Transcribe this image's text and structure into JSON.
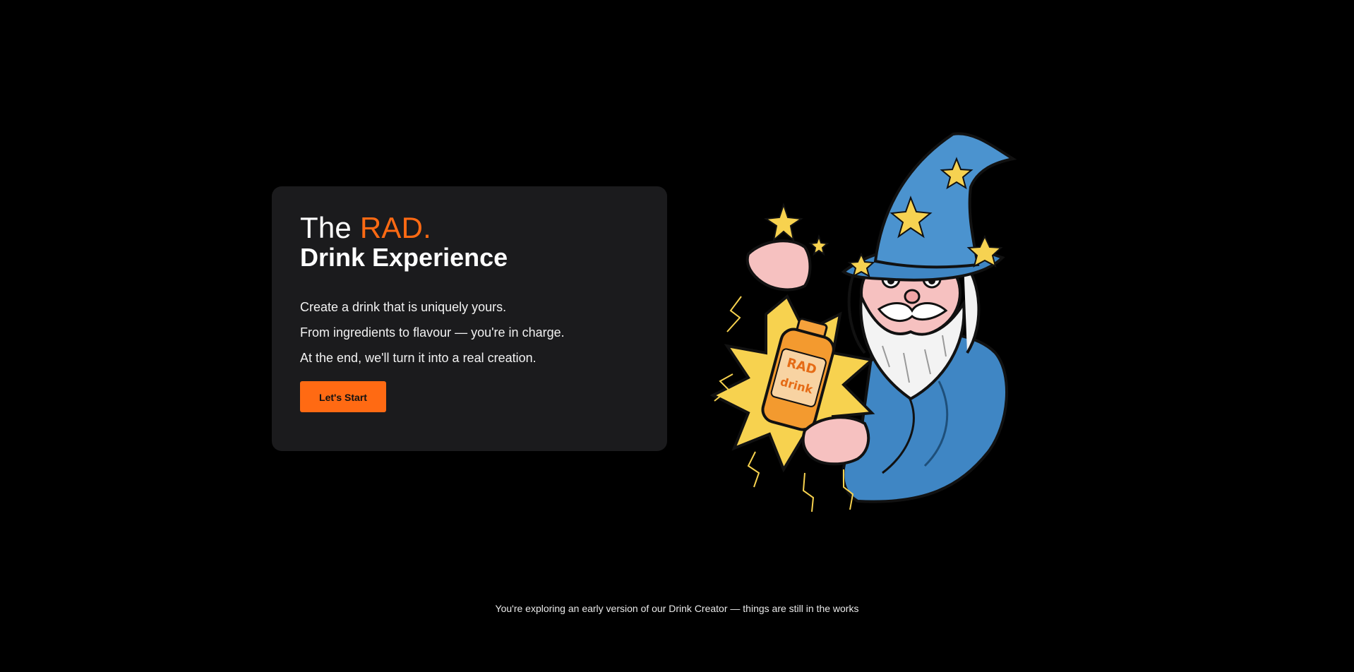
{
  "hero": {
    "title_prefix": "The",
    "title_brand": "RAD.",
    "title_line2": "Drink Experience",
    "lines": [
      "Create a drink that is uniquely yours.",
      "From ingredients to flavour — you're in charge.",
      "At the end, we'll turn it into a real creation."
    ],
    "cta_label": "Let's Start"
  },
  "illustration": {
    "name": "wizard-holding-rad-drink-bottle",
    "bottle_brand": "RAD",
    "bottle_word": "drink"
  },
  "footer": {
    "note": "You're exploring an early version of our Drink Creator — things are still in the works"
  },
  "colors": {
    "accent": "#ff6a13",
    "card": "#1b1b1d",
    "background": "#000000"
  }
}
